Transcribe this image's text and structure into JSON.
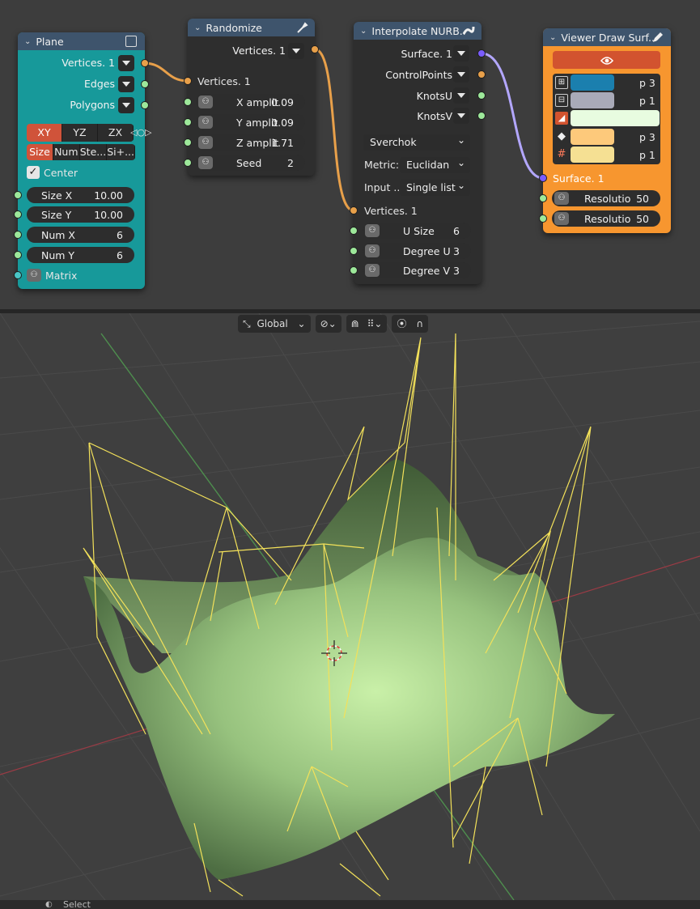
{
  "nodes": {
    "plane": {
      "title": "Plane",
      "outputs": [
        "Vertices. 1",
        "Edges",
        "Polygons"
      ],
      "plane_modes": [
        "XY",
        "YZ",
        "ZX"
      ],
      "dim_modes": [
        "Size",
        "Num",
        "Ste...",
        "Si+..."
      ],
      "center_label": "Center",
      "fields": [
        {
          "label": "Size X",
          "value": "10.00"
        },
        {
          "label": "Size Y",
          "value": "10.00"
        },
        {
          "label": "Num X",
          "value": "6"
        },
        {
          "label": "Num Y",
          "value": "6"
        }
      ],
      "matrix_label": "Matrix",
      "body_color": "#17999a"
    },
    "randomize": {
      "title": "Randomize",
      "output": "Vertices. 1",
      "input": "Vertices. 1",
      "fields": [
        {
          "label": "X amplit",
          "value": "0.09"
        },
        {
          "label": "Y amplit",
          "value": "0.09"
        },
        {
          "label": "Z amplit",
          "value": "1.71"
        },
        {
          "label": "Seed",
          "value": "2"
        }
      ]
    },
    "interpolate": {
      "title": "Interpolate NURB...",
      "outputs": [
        "Surface. 1",
        "ControlPoints",
        "KnotsU",
        "KnotsV"
      ],
      "implementation": "Sverchok",
      "metric_label": "Metric:",
      "metric_value": "Euclidan",
      "input_label": "Input ...",
      "input_value": "Single list",
      "vertices_input": "Vertices. 1",
      "fields": [
        {
          "label": "U Size",
          "value": "6"
        },
        {
          "label": "Degree U",
          "value": "3"
        },
        {
          "label": "Degree V",
          "value": "3"
        }
      ]
    },
    "viewer": {
      "title": "Viewer Draw Surf...",
      "color_rows": [
        {
          "icon": "vertices-icon",
          "color": "#1b7fae",
          "value": "p 3"
        },
        {
          "icon": "edges-icon",
          "color": "#a9aab8",
          "value": "p 1"
        },
        {
          "icon": "faces-icon",
          "color": "#e8fce0",
          "value": ""
        },
        {
          "icon": "control-points-icon",
          "color": "#fdc97b",
          "value": "p 3"
        },
        {
          "icon": "control-grid-icon",
          "color": "#f5e093",
          "value": "p 1"
        }
      ],
      "surface_input": "Surface. 1",
      "fields": [
        {
          "label": "Resolutio",
          "value": "50"
        },
        {
          "label": "Resolutio",
          "value": "50"
        }
      ],
      "body_color": "#f7962f",
      "eye_button_color": "#d2532f"
    }
  },
  "viewport_toolbar": {
    "orientation": "Global"
  },
  "statusbar": {
    "hint": "Select"
  },
  "colors": {
    "link_orange": "#e8a04a",
    "link_purple": "#b3a7ff",
    "wire_yellow": "#f3e15a",
    "surface_green": "#8fb57a"
  }
}
